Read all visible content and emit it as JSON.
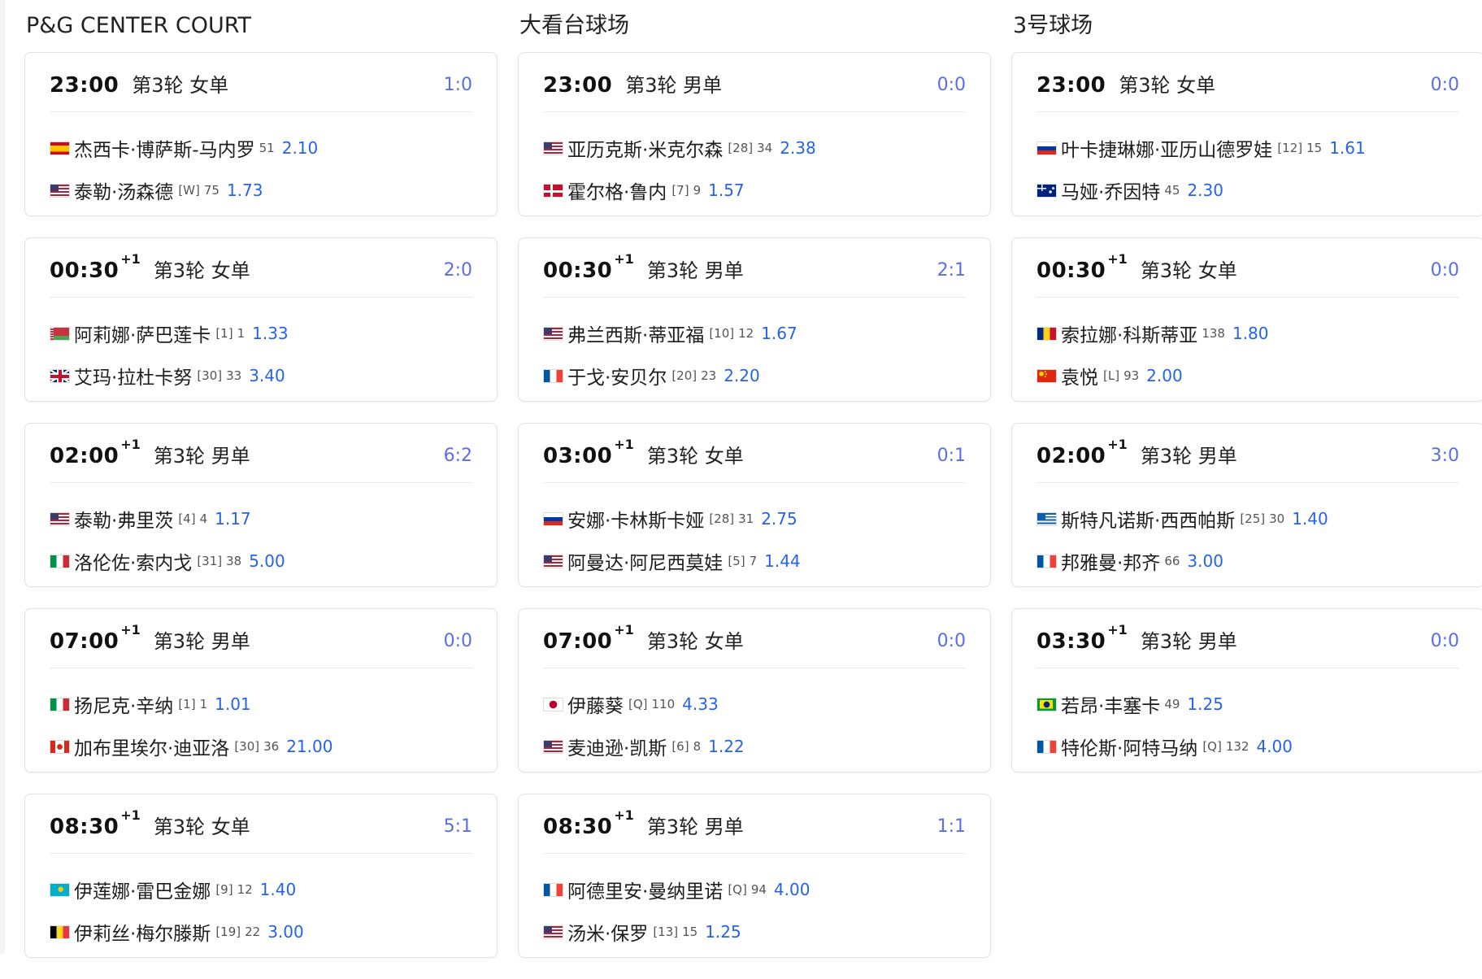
{
  "courts": [
    {
      "name": "P&G CENTER COURT",
      "matches": [
        {
          "time": "23:00",
          "plus": "",
          "round": "第3轮 女单",
          "score": "1:0",
          "players": [
            {
              "flag": "es",
              "name": "杰西卡·博萨斯-马内罗",
              "seed": "",
              "rank": "51",
              "odds": "2.10"
            },
            {
              "flag": "us",
              "name": "泰勒·汤森德",
              "seed": "[W]",
              "rank": "75",
              "odds": "1.73"
            }
          ]
        },
        {
          "time": "00:30",
          "plus": "+1",
          "round": "第3轮 女单",
          "score": "2:0",
          "players": [
            {
              "flag": "by",
              "name": "阿莉娜·萨巴莲卡",
              "seed": "[1]",
              "rank": "1",
              "odds": "1.33"
            },
            {
              "flag": "gb",
              "name": "艾玛·拉杜卡努",
              "seed": "[30]",
              "rank": "33",
              "odds": "3.40"
            }
          ]
        },
        {
          "time": "02:00",
          "plus": "+1",
          "round": "第3轮 男单",
          "score": "6:2",
          "players": [
            {
              "flag": "us",
              "name": "泰勒·弗里茨",
              "seed": "[4]",
              "rank": "4",
              "odds": "1.17"
            },
            {
              "flag": "it",
              "name": "洛伦佐·索内戈",
              "seed": "[31]",
              "rank": "38",
              "odds": "5.00"
            }
          ]
        },
        {
          "time": "07:00",
          "plus": "+1",
          "round": "第3轮 男单",
          "score": "0:0",
          "players": [
            {
              "flag": "it",
              "name": "扬尼克·辛纳",
              "seed": "[1]",
              "rank": "1",
              "odds": "1.01"
            },
            {
              "flag": "ca",
              "name": "加布里埃尔·迪亚洛",
              "seed": "[30]",
              "rank": "36",
              "odds": "21.00"
            }
          ]
        },
        {
          "time": "08:30",
          "plus": "+1",
          "round": "第3轮 女单",
          "score": "5:1",
          "players": [
            {
              "flag": "kz",
              "name": "伊莲娜·雷巴金娜",
              "seed": "[9]",
              "rank": "12",
              "odds": "1.40"
            },
            {
              "flag": "be",
              "name": "伊莉丝·梅尔滕斯",
              "seed": "[19]",
              "rank": "22",
              "odds": "3.00"
            }
          ]
        }
      ]
    },
    {
      "name": "大看台球场",
      "matches": [
        {
          "time": "23:00",
          "plus": "",
          "round": "第3轮 男单",
          "score": "0:0",
          "players": [
            {
              "flag": "us",
              "name": "亚历克斯·米克尔森",
              "seed": "[28]",
              "rank": "34",
              "odds": "2.38"
            },
            {
              "flag": "dk",
              "name": "霍尔格·鲁内",
              "seed": "[7]",
              "rank": "9",
              "odds": "1.57"
            }
          ]
        },
        {
          "time": "00:30",
          "plus": "+1",
          "round": "第3轮 男单",
          "score": "2:1",
          "players": [
            {
              "flag": "us",
              "name": "弗兰西斯·蒂亚福",
              "seed": "[10]",
              "rank": "12",
              "odds": "1.67"
            },
            {
              "flag": "fr",
              "name": "于戈·安贝尔",
              "seed": "[20]",
              "rank": "23",
              "odds": "2.20"
            }
          ]
        },
        {
          "time": "03:00",
          "plus": "+1",
          "round": "第3轮 女单",
          "score": "0:1",
          "players": [
            {
              "flag": "ru",
              "name": "安娜·卡林斯卡娅",
              "seed": "[28]",
              "rank": "31",
              "odds": "2.75"
            },
            {
              "flag": "us",
              "name": "阿曼达·阿尼西莫娃",
              "seed": "[5]",
              "rank": "7",
              "odds": "1.44"
            }
          ]
        },
        {
          "time": "07:00",
          "plus": "+1",
          "round": "第3轮 女单",
          "score": "0:0",
          "players": [
            {
              "flag": "jp",
              "name": "伊藤葵",
              "seed": "[Q]",
              "rank": "110",
              "odds": "4.33"
            },
            {
              "flag": "us",
              "name": "麦迪逊·凯斯",
              "seed": "[6]",
              "rank": "8",
              "odds": "1.22"
            }
          ]
        },
        {
          "time": "08:30",
          "plus": "+1",
          "round": "第3轮 男单",
          "score": "1:1",
          "players": [
            {
              "flag": "fr",
              "name": "阿德里安·曼纳里诺",
              "seed": "[Q]",
              "rank": "94",
              "odds": "4.00"
            },
            {
              "flag": "us",
              "name": "汤米·保罗",
              "seed": "[13]",
              "rank": "15",
              "odds": "1.25"
            }
          ]
        }
      ]
    },
    {
      "name": "3号球场",
      "matches": [
        {
          "time": "23:00",
          "plus": "",
          "round": "第3轮 女单",
          "score": "0:0",
          "players": [
            {
              "flag": "ru",
              "name": "叶卡捷琳娜·亚历山德罗娃",
              "seed": "[12]",
              "rank": "15",
              "odds": "1.61"
            },
            {
              "flag": "au",
              "name": "马娅·乔因特",
              "seed": "",
              "rank": "45",
              "odds": "2.30"
            }
          ]
        },
        {
          "time": "00:30",
          "plus": "+1",
          "round": "第3轮 女单",
          "score": "0:0",
          "players": [
            {
              "flag": "ro",
              "name": "索拉娜·科斯蒂亚",
              "seed": "",
              "rank": "138",
              "odds": "1.80"
            },
            {
              "flag": "cn",
              "name": "袁悦",
              "seed": "[L]",
              "rank": "93",
              "odds": "2.00"
            }
          ]
        },
        {
          "time": "02:00",
          "plus": "+1",
          "round": "第3轮 男单",
          "score": "3:0",
          "players": [
            {
              "flag": "gr",
              "name": "斯特凡诺斯·西西帕斯",
              "seed": "[25]",
              "rank": "30",
              "odds": "1.40"
            },
            {
              "flag": "fr",
              "name": "邦雅曼·邦齐",
              "seed": "",
              "rank": "66",
              "odds": "3.00"
            }
          ]
        },
        {
          "time": "03:30",
          "plus": "+1",
          "round": "第3轮 男单",
          "score": "0:0",
          "players": [
            {
              "flag": "br",
              "name": "若昂·丰塞卡",
              "seed": "",
              "rank": "49",
              "odds": "1.25"
            },
            {
              "flag": "fr",
              "name": "特伦斯·阿特马纳",
              "seed": "[Q]",
              "rank": "132",
              "odds": "4.00"
            }
          ]
        }
      ]
    }
  ],
  "colors": {
    "score": "#5a6ee8",
    "odds": "#2563eb",
    "border": "#dfe3e8"
  }
}
